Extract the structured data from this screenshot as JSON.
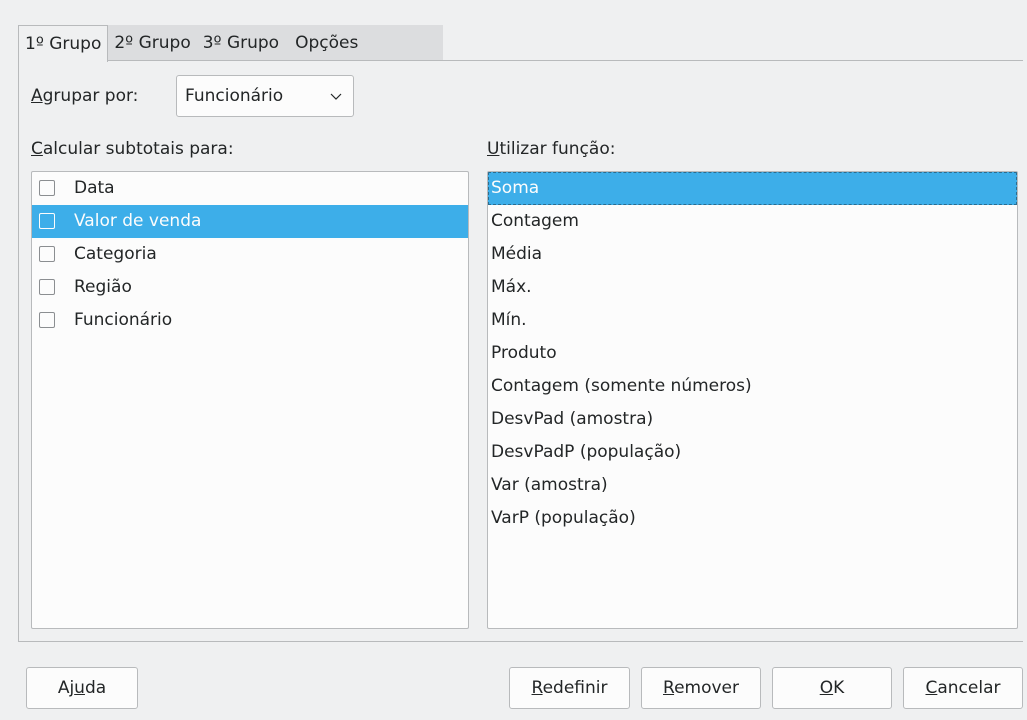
{
  "tabs": [
    {
      "label": "1º Grupo",
      "active": true
    },
    {
      "label": "2º Grupo",
      "active": false
    },
    {
      "label": "3º Grupo",
      "active": false
    },
    {
      "label": "Opções",
      "active": false
    }
  ],
  "group_by": {
    "label_mnemonic": "A",
    "label_rest": "grupar por:",
    "selected": "Funcionário"
  },
  "subtotals": {
    "label_mnemonic": "C",
    "label_rest": "alcular subtotais para:",
    "items": [
      {
        "label": "Data",
        "checked": false,
        "selected": false
      },
      {
        "label": "Valor de venda",
        "checked": false,
        "selected": true
      },
      {
        "label": "Categoria",
        "checked": false,
        "selected": false
      },
      {
        "label": "Região",
        "checked": false,
        "selected": false
      },
      {
        "label": "Funcionário",
        "checked": false,
        "selected": false
      }
    ]
  },
  "function": {
    "label_mnemonic": "U",
    "label_rest": "tilizar função:",
    "items": [
      {
        "label": "Soma",
        "selected": true
      },
      {
        "label": "Contagem",
        "selected": false
      },
      {
        "label": "Média",
        "selected": false
      },
      {
        "label": "Máx.",
        "selected": false
      },
      {
        "label": "Mín.",
        "selected": false
      },
      {
        "label": "Produto",
        "selected": false
      },
      {
        "label": "Contagem (somente números)",
        "selected": false
      },
      {
        "label": "DesvPad (amostra)",
        "selected": false
      },
      {
        "label": "DesvPadP (população)",
        "selected": false
      },
      {
        "label": "Var (amostra)",
        "selected": false
      },
      {
        "label": "VarP (população)",
        "selected": false
      }
    ]
  },
  "buttons": {
    "help": {
      "pre": "Aj",
      "mn": "u",
      "post": "da"
    },
    "reset": {
      "pre": "",
      "mn": "R",
      "post": "edefinir"
    },
    "remove": {
      "pre": "",
      "mn": "R",
      "post": "emover"
    },
    "ok": {
      "pre": "",
      "mn": "O",
      "post": "K"
    },
    "cancel": {
      "pre": "",
      "mn": "C",
      "post": "ancelar"
    }
  },
  "colors": {
    "selection": "#3daee9",
    "window_bg": "#eff0f1"
  }
}
